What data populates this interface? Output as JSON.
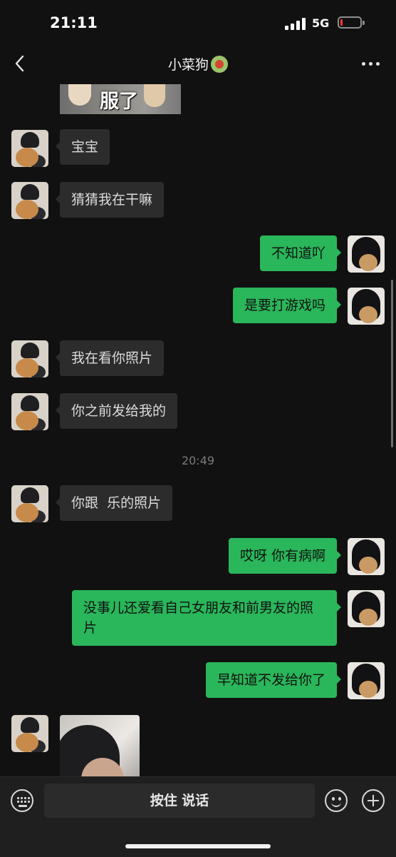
{
  "status_bar": {
    "time": "21:11",
    "network": "5G",
    "battery_level": 0.08,
    "battery_color": "#ff3b30"
  },
  "nav": {
    "title": "小菜狗",
    "back_icon": "chevron-left-icon",
    "more_icon": "more-dots-icon"
  },
  "chat": {
    "top_image_caption": "服了",
    "messages": [
      {
        "side": "in",
        "text": "宝宝"
      },
      {
        "side": "in",
        "text": "猜猜我在干嘛"
      },
      {
        "side": "out",
        "text": "不知道吖"
      },
      {
        "side": "out",
        "text": "是要打游戏吗"
      },
      {
        "side": "in",
        "text": "我在看你照片"
      },
      {
        "side": "in",
        "text": "你之前发给我的"
      },
      {
        "side": "in",
        "text": "你跟  乐的照片"
      },
      {
        "side": "out",
        "text": "哎呀 你有病啊"
      },
      {
        "side": "out",
        "text": "没事儿还爱看自己女朋友和前男友的照片"
      },
      {
        "side": "out",
        "text": "早知道不发给你了"
      }
    ],
    "timestamp": "20:49"
  },
  "input_bar": {
    "hold_to_talk_label": "按住 说话",
    "keyboard_icon": "keyboard-icon",
    "emoji_icon": "emoji-icon",
    "plus_icon": "plus-icon"
  },
  "colors": {
    "background": "#111111",
    "incoming_bubble": "#2c2c2c",
    "outgoing_bubble": "#2ab65a"
  }
}
